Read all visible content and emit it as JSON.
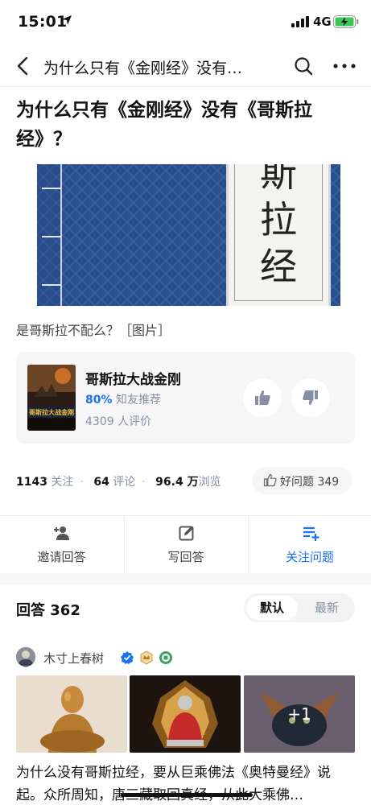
{
  "status_bar": {
    "time": "15:01",
    "network": "4G"
  },
  "nav": {
    "title": "为什么只有《金刚经》没有…"
  },
  "question": {
    "title": "为什么只有《金刚经》没有《哥斯拉经》？",
    "cover_text": "斯拉经",
    "description": "是哥斯拉不配么？［图片］"
  },
  "movie_card": {
    "title": "哥斯拉大战金刚",
    "rating_percent": "80%",
    "rating_label": "知友推荐",
    "review_count": "4309 人评价",
    "poster_text": "哥斯拉大战金刚"
  },
  "stats": {
    "follow_count": "1143",
    "follow_label": "关注",
    "comment_count": "64",
    "comment_label": "评论",
    "view_count": "96.4 万",
    "view_label": "浏览",
    "good_question": "好问题 349"
  },
  "actions": {
    "invite": "邀请回答",
    "write": "写回答",
    "follow": "关注问题"
  },
  "answers": {
    "header": "回答 362",
    "sort_default": "默认",
    "sort_latest": "最新"
  },
  "answer": {
    "author": "木寸上春树",
    "more_images": "+1",
    "text": "为什么没有哥斯拉经，要从巨乘佛法《奥特曼经》说起。众所周知，唐三藏取回真经，从此大乘佛…"
  },
  "colors": {
    "accent": "#1772f6",
    "cover_blue": "#2a4f8f",
    "muted": "#8590a6"
  }
}
